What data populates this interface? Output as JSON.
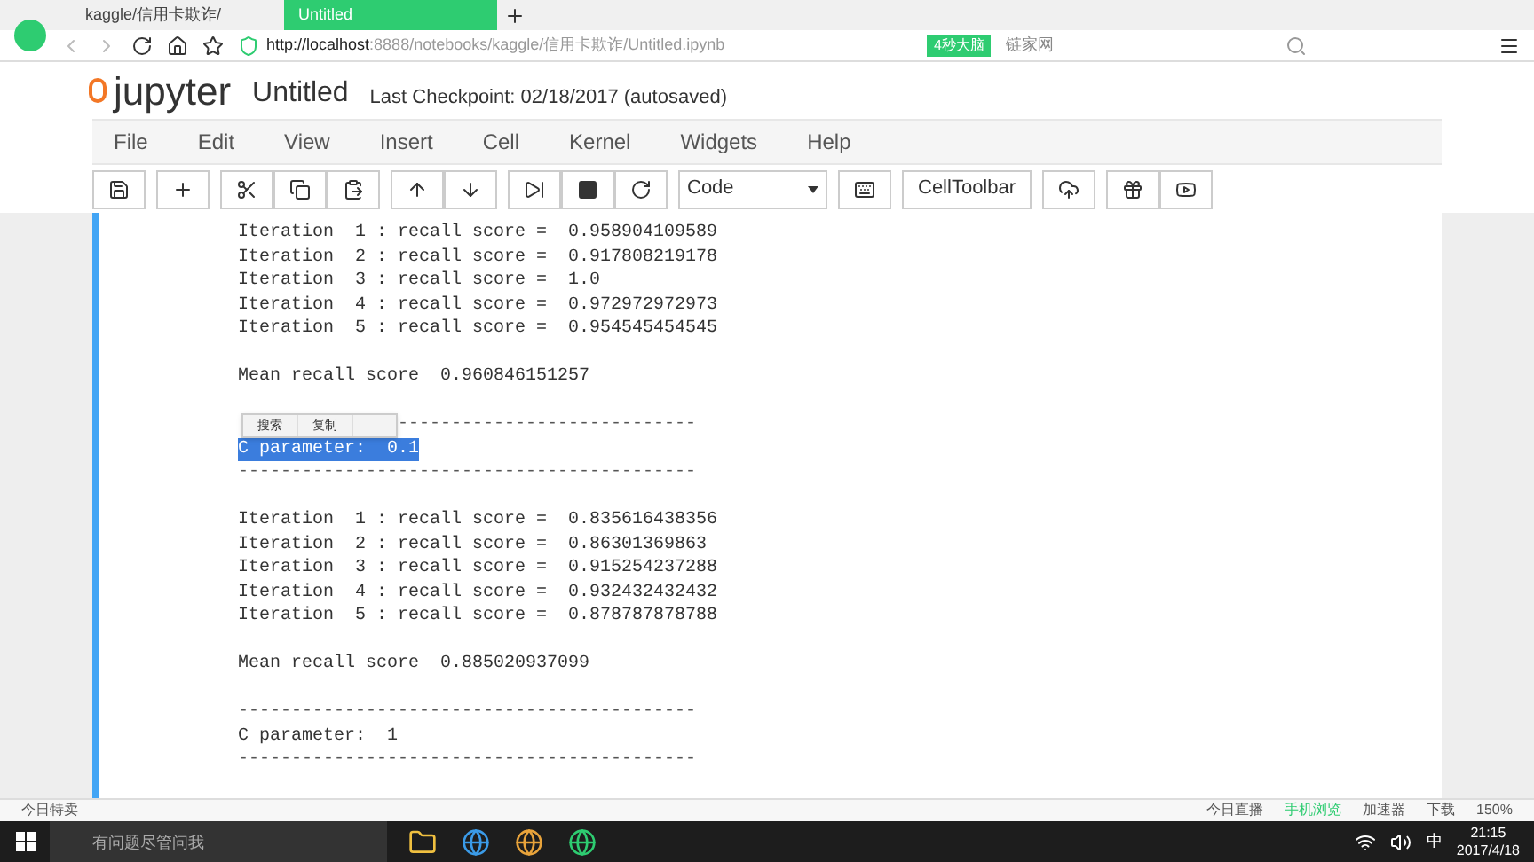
{
  "browser": {
    "tabs": [
      {
        "label": "kaggle/信用卡欺诈/",
        "selected": false
      },
      {
        "label": "Untitled",
        "selected": true
      }
    ],
    "url_host": "http://localhost",
    "url_path": ":8888/notebooks/kaggle/信用卡欺诈/Untitled.ipynb",
    "badge": "4秒大脑",
    "search": {
      "placeholder": "链家网"
    }
  },
  "notebook": {
    "logo": "jupyter",
    "title": "Untitled",
    "checkpoint": "Last Checkpoint: 02/18/2017 (autosaved)"
  },
  "menu": [
    "File",
    "Edit",
    "View",
    "Insert",
    "Cell",
    "Kernel",
    "Widgets",
    "Help"
  ],
  "toolbar": {
    "cell_type": "Code",
    "celltoolbar": "CellToolbar"
  },
  "output": [
    {
      "kind": "text",
      "text": "Iteration  1 : recall score =  0.958904109589"
    },
    {
      "kind": "text",
      "text": "Iteration  2 : recall score =  0.917808219178"
    },
    {
      "kind": "text",
      "text": "Iteration  3 : recall score =  1.0"
    },
    {
      "kind": "text",
      "text": "Iteration  4 : recall score =  0.972972972973"
    },
    {
      "kind": "text",
      "text": "Iteration  5 : recall score =  0.954545454545"
    },
    {
      "kind": "blank"
    },
    {
      "kind": "text",
      "text": "Mean recall score  0.960846151257"
    },
    {
      "kind": "blank"
    },
    {
      "kind": "popup_rule",
      "popup": [
        "搜索",
        "复制"
      ],
      "text": "----------------------------"
    },
    {
      "kind": "selected",
      "text": "C parameter:  0.1"
    },
    {
      "kind": "rule",
      "text": "-------------------------------------------"
    },
    {
      "kind": "blank"
    },
    {
      "kind": "text",
      "text": "Iteration  1 : recall score =  0.835616438356"
    },
    {
      "kind": "text",
      "text": "Iteration  2 : recall score =  0.86301369863"
    },
    {
      "kind": "text",
      "text": "Iteration  3 : recall score =  0.915254237288"
    },
    {
      "kind": "text",
      "text": "Iteration  4 : recall score =  0.932432432432"
    },
    {
      "kind": "text",
      "text": "Iteration  5 : recall score =  0.878787878788"
    },
    {
      "kind": "blank"
    },
    {
      "kind": "text",
      "text": "Mean recall score  0.885020937099"
    },
    {
      "kind": "blank"
    },
    {
      "kind": "rule",
      "text": "-------------------------------------------"
    },
    {
      "kind": "text",
      "text": "C parameter:  1"
    },
    {
      "kind": "rule",
      "text": "-------------------------------------------"
    }
  ],
  "status_bar": {
    "left": "今日特卖",
    "items": [
      "今日直播",
      "手机浏览",
      "加速器",
      "下载"
    ],
    "zoom": "150%"
  },
  "taskbar": {
    "search": {
      "placeholder": "有问题尽管问我"
    },
    "input_method": "中",
    "time": "21:15",
    "date": "2017/4/18"
  }
}
